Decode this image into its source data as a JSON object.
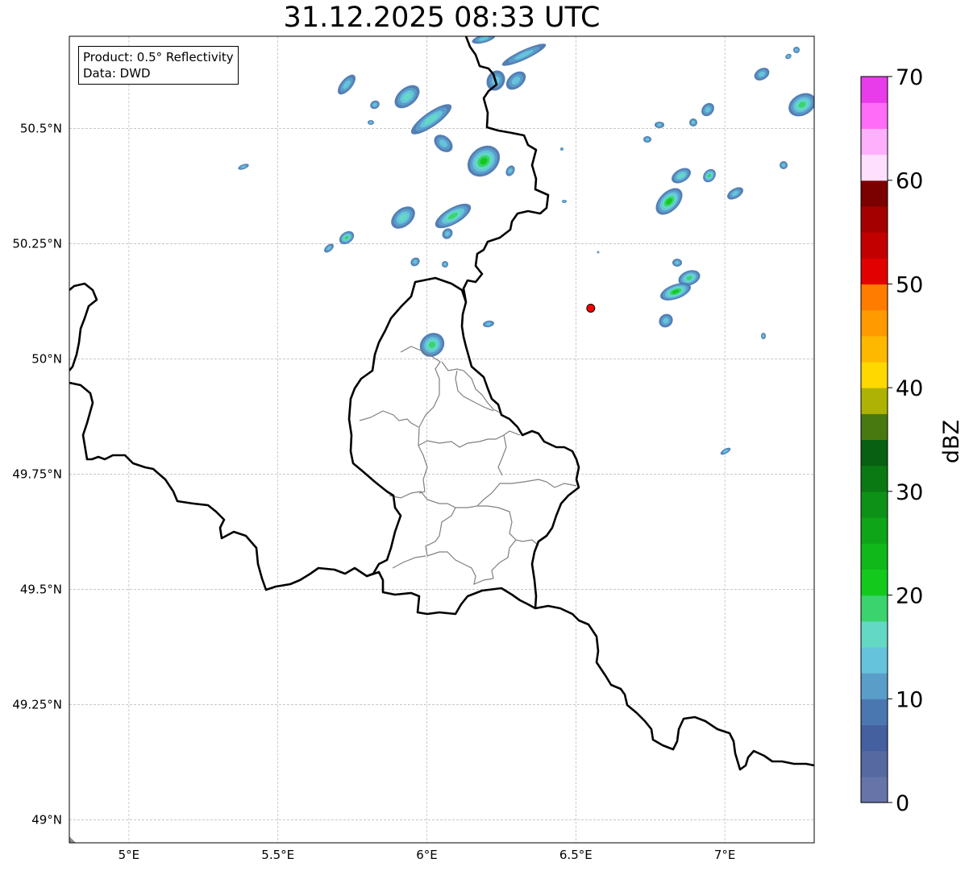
{
  "title": "31.12.2025 08:33 UTC",
  "info": {
    "product": "Product: 0.5° Reflectivity",
    "source": "Data: DWD"
  },
  "axes": {
    "lon_ticks": [
      "5°E",
      "5.5°E",
      "6°E",
      "6.5°E",
      "7°E"
    ],
    "lat_ticks": [
      "50.5°N",
      "50.25°N",
      "50°N",
      "49.75°N",
      "49.5°N",
      "49.25°N",
      "49°N"
    ],
    "lon_range": [
      4.8,
      7.3
    ],
    "lat_range": [
      48.95,
      50.7
    ],
    "grid": true
  },
  "marker": {
    "name": "radar-site",
    "lon": 6.55,
    "lat": 50.11,
    "color": "#ff0000"
  },
  "colorbar": {
    "label": "dBZ",
    "ticks": [
      "0",
      "10",
      "20",
      "30",
      "40",
      "50",
      "60",
      "70"
    ],
    "range": [
      0,
      70
    ],
    "step": 2.5,
    "colors": [
      "#6674a8",
      "#5669a1",
      "#45609f",
      "#4b77b0",
      "#5a9dc9",
      "#66c3dc",
      "#63d9c5",
      "#3bd36e",
      "#13c91c",
      "#10b81a",
      "#0fa518",
      "#0e9117",
      "#0b7913",
      "#086012",
      "#487910",
      "#aeb204",
      "#ffd800",
      "#ffb800",
      "#ff9a00",
      "#ff7c00",
      "#e20000",
      "#c30000",
      "#a50000",
      "#7b0000",
      "#ffdffe",
      "#ffb0fc",
      "#ff6df8",
      "#e83cea"
    ]
  },
  "chart_data": {
    "type": "heatmap",
    "title": "31.12.2025 08:33 UTC",
    "colorbar_label": "dBZ",
    "zlim": [
      0,
      70
    ],
    "xlim": [
      4.8,
      7.3
    ],
    "ylim": [
      48.95,
      50.7
    ]
  }
}
